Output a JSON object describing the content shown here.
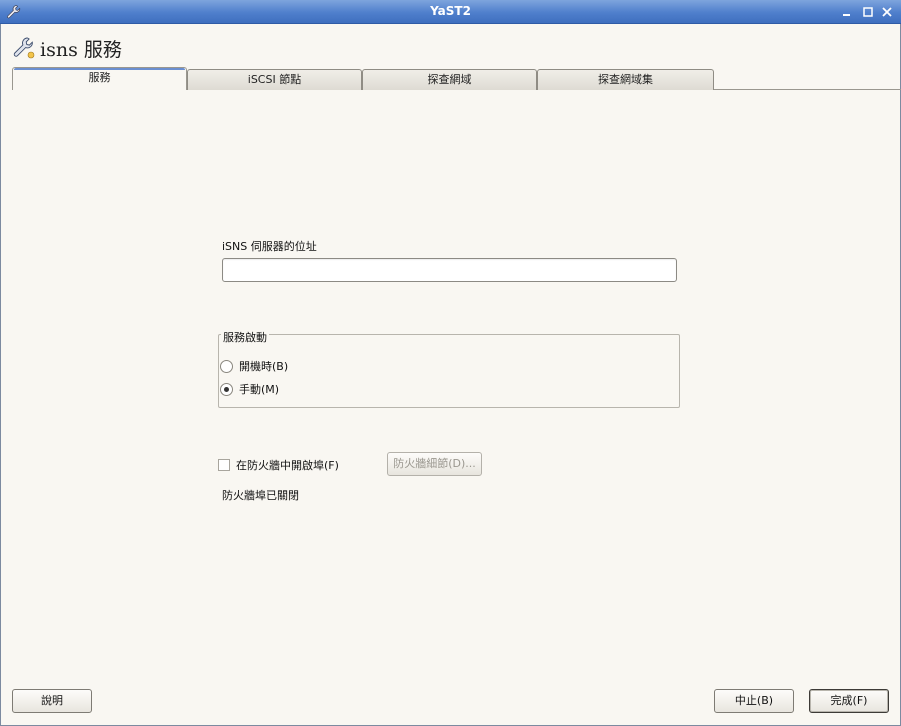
{
  "window": {
    "title": "YaST2",
    "controls": [
      "minimize-icon",
      "maximize-icon",
      "close-icon"
    ]
  },
  "header": {
    "title": "isns  服務",
    "icon": "wrench-icon"
  },
  "tabs": [
    {
      "label": "服務",
      "active": true
    },
    {
      "label": "iSCSI  節點",
      "active": false
    },
    {
      "label": "探查網域",
      "active": false
    },
    {
      "label": "探查網域集",
      "active": false
    }
  ],
  "server": {
    "label": "iSNS  伺服器的位址",
    "value": "",
    "placeholder": ""
  },
  "service_start": {
    "legend": "服務啟動",
    "options": [
      {
        "label": "開機時(B)",
        "checked": false
      },
      {
        "label": "手動(M)",
        "checked": true
      }
    ]
  },
  "firewall": {
    "checkbox_label": "在防火牆中開啟埠(F)",
    "checked": false,
    "details_button": "防火牆細節(D)...",
    "status": "防火牆埠已關閉"
  },
  "buttons": {
    "help": "說明",
    "abort": "中止(B)",
    "finish": "完成(F)"
  },
  "colors": {
    "titlebar": "#4f7fcc",
    "background": "#f9f7f2",
    "tab_accent": "#6b8fd0"
  }
}
